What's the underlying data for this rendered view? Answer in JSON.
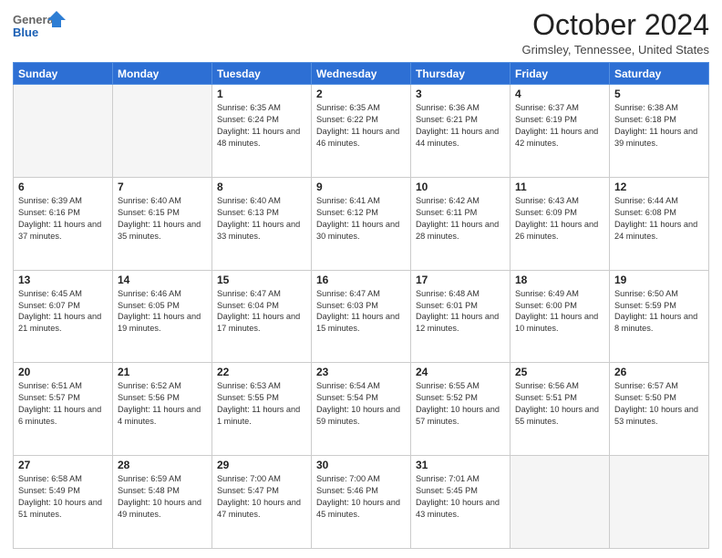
{
  "header": {
    "logo_general": "General",
    "logo_blue": "Blue",
    "month_title": "October 2024",
    "location": "Grimsley, Tennessee, United States"
  },
  "days_of_week": [
    "Sunday",
    "Monday",
    "Tuesday",
    "Wednesday",
    "Thursday",
    "Friday",
    "Saturday"
  ],
  "weeks": [
    [
      {
        "day": "",
        "content": ""
      },
      {
        "day": "",
        "content": ""
      },
      {
        "day": "1",
        "content": "Sunrise: 6:35 AM\nSunset: 6:24 PM\nDaylight: 11 hours and 48 minutes."
      },
      {
        "day": "2",
        "content": "Sunrise: 6:35 AM\nSunset: 6:22 PM\nDaylight: 11 hours and 46 minutes."
      },
      {
        "day": "3",
        "content": "Sunrise: 6:36 AM\nSunset: 6:21 PM\nDaylight: 11 hours and 44 minutes."
      },
      {
        "day": "4",
        "content": "Sunrise: 6:37 AM\nSunset: 6:19 PM\nDaylight: 11 hours and 42 minutes."
      },
      {
        "day": "5",
        "content": "Sunrise: 6:38 AM\nSunset: 6:18 PM\nDaylight: 11 hours and 39 minutes."
      }
    ],
    [
      {
        "day": "6",
        "content": "Sunrise: 6:39 AM\nSunset: 6:16 PM\nDaylight: 11 hours and 37 minutes."
      },
      {
        "day": "7",
        "content": "Sunrise: 6:40 AM\nSunset: 6:15 PM\nDaylight: 11 hours and 35 minutes."
      },
      {
        "day": "8",
        "content": "Sunrise: 6:40 AM\nSunset: 6:13 PM\nDaylight: 11 hours and 33 minutes."
      },
      {
        "day": "9",
        "content": "Sunrise: 6:41 AM\nSunset: 6:12 PM\nDaylight: 11 hours and 30 minutes."
      },
      {
        "day": "10",
        "content": "Sunrise: 6:42 AM\nSunset: 6:11 PM\nDaylight: 11 hours and 28 minutes."
      },
      {
        "day": "11",
        "content": "Sunrise: 6:43 AM\nSunset: 6:09 PM\nDaylight: 11 hours and 26 minutes."
      },
      {
        "day": "12",
        "content": "Sunrise: 6:44 AM\nSunset: 6:08 PM\nDaylight: 11 hours and 24 minutes."
      }
    ],
    [
      {
        "day": "13",
        "content": "Sunrise: 6:45 AM\nSunset: 6:07 PM\nDaylight: 11 hours and 21 minutes."
      },
      {
        "day": "14",
        "content": "Sunrise: 6:46 AM\nSunset: 6:05 PM\nDaylight: 11 hours and 19 minutes."
      },
      {
        "day": "15",
        "content": "Sunrise: 6:47 AM\nSunset: 6:04 PM\nDaylight: 11 hours and 17 minutes."
      },
      {
        "day": "16",
        "content": "Sunrise: 6:47 AM\nSunset: 6:03 PM\nDaylight: 11 hours and 15 minutes."
      },
      {
        "day": "17",
        "content": "Sunrise: 6:48 AM\nSunset: 6:01 PM\nDaylight: 11 hours and 12 minutes."
      },
      {
        "day": "18",
        "content": "Sunrise: 6:49 AM\nSunset: 6:00 PM\nDaylight: 11 hours and 10 minutes."
      },
      {
        "day": "19",
        "content": "Sunrise: 6:50 AM\nSunset: 5:59 PM\nDaylight: 11 hours and 8 minutes."
      }
    ],
    [
      {
        "day": "20",
        "content": "Sunrise: 6:51 AM\nSunset: 5:57 PM\nDaylight: 11 hours and 6 minutes."
      },
      {
        "day": "21",
        "content": "Sunrise: 6:52 AM\nSunset: 5:56 PM\nDaylight: 11 hours and 4 minutes."
      },
      {
        "day": "22",
        "content": "Sunrise: 6:53 AM\nSunset: 5:55 PM\nDaylight: 11 hours and 1 minute."
      },
      {
        "day": "23",
        "content": "Sunrise: 6:54 AM\nSunset: 5:54 PM\nDaylight: 10 hours and 59 minutes."
      },
      {
        "day": "24",
        "content": "Sunrise: 6:55 AM\nSunset: 5:52 PM\nDaylight: 10 hours and 57 minutes."
      },
      {
        "day": "25",
        "content": "Sunrise: 6:56 AM\nSunset: 5:51 PM\nDaylight: 10 hours and 55 minutes."
      },
      {
        "day": "26",
        "content": "Sunrise: 6:57 AM\nSunset: 5:50 PM\nDaylight: 10 hours and 53 minutes."
      }
    ],
    [
      {
        "day": "27",
        "content": "Sunrise: 6:58 AM\nSunset: 5:49 PM\nDaylight: 10 hours and 51 minutes."
      },
      {
        "day": "28",
        "content": "Sunrise: 6:59 AM\nSunset: 5:48 PM\nDaylight: 10 hours and 49 minutes."
      },
      {
        "day": "29",
        "content": "Sunrise: 7:00 AM\nSunset: 5:47 PM\nDaylight: 10 hours and 47 minutes."
      },
      {
        "day": "30",
        "content": "Sunrise: 7:00 AM\nSunset: 5:46 PM\nDaylight: 10 hours and 45 minutes."
      },
      {
        "day": "31",
        "content": "Sunrise: 7:01 AM\nSunset: 5:45 PM\nDaylight: 10 hours and 43 minutes."
      },
      {
        "day": "",
        "content": ""
      },
      {
        "day": "",
        "content": ""
      }
    ]
  ]
}
